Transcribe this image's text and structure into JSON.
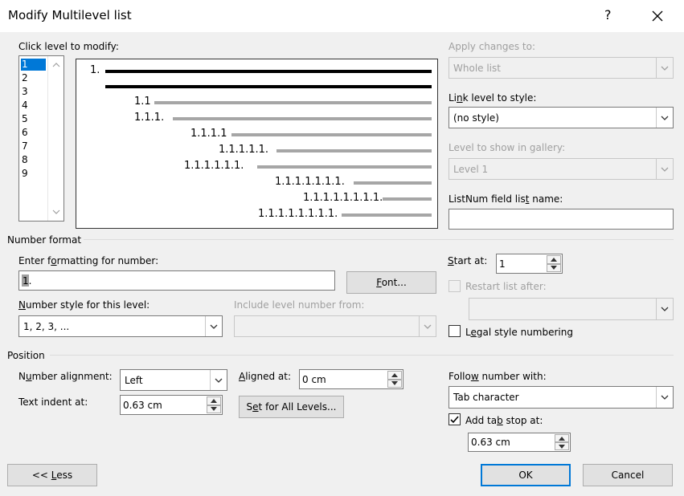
{
  "title": "Modify Multilevel list",
  "help_label": "?",
  "levels_label": "Click level to modify:",
  "levels": [
    "1",
    "2",
    "3",
    "4",
    "5",
    "6",
    "7",
    "8",
    "9"
  ],
  "preview": {
    "n1": "1.",
    "n2": "1.1",
    "n3": "1.1.1.",
    "n4": "1.1.1.1",
    "n5": "1.1.1.1.1.",
    "n6": "1.1.1.1.1.1.",
    "n7": "1.1.1.1.1.1.1.",
    "n8": "1.1.1.1.1.1.1.1.",
    "n9": "1.1.1.1.1.1.1.1."
  },
  "apply_changes_label": "Apply changes to:",
  "apply_changes_value": "Whole list",
  "link_level_label": "Link level to style:",
  "link_level_value": "(no style)",
  "gallery_label": "Level to show in gallery:",
  "gallery_value": "Level 1",
  "listnum_label": "ListNum field list name:",
  "listnum_value": "",
  "number_format_header": "Number format",
  "enter_format_label": "Enter formatting for number:",
  "format_value": "1.",
  "font_button": "Font...",
  "number_style_label": "Number style for this level:",
  "number_style_value": "1, 2, 3, ...",
  "include_level_label": "Include level number from:",
  "include_level_value": "",
  "start_at_label": "Start at:",
  "start_at_value": "1",
  "restart_label": "Restart list after:",
  "restart_value": "",
  "legal_label": "Legal style numbering",
  "position_header": "Position",
  "number_alignment_label": "Number alignment:",
  "number_alignment_value": "Left",
  "aligned_at_label": "Aligned at:",
  "aligned_at_value": "0 cm",
  "text_indent_label": "Text indent at:",
  "text_indent_value": "0.63 cm",
  "set_all_button": "Set for All Levels...",
  "follow_label": "Follow number with:",
  "follow_value": "Tab character",
  "add_tab_label": "Add tab stop at:",
  "add_tab_checked": true,
  "tab_value": "0.63 cm",
  "less_button": "<< Less",
  "ok_button": "OK",
  "cancel_button": "Cancel"
}
